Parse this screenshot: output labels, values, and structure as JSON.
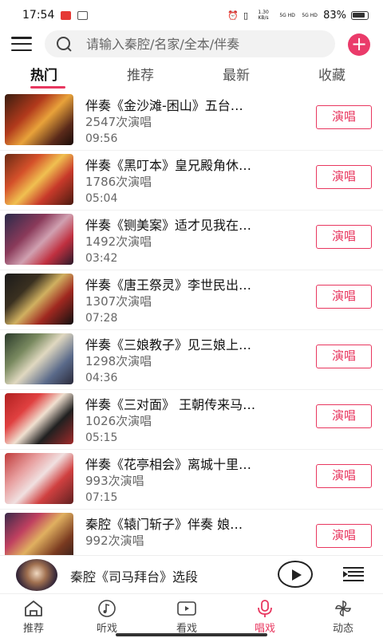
{
  "status_bar": {
    "time": "17:54",
    "network_speed": "1.30 KB/s",
    "signal_1": "5G HD",
    "signal_2": "5G HD",
    "battery": "83%"
  },
  "search": {
    "placeholder": "请输入秦腔/名家/全本/伴奏"
  },
  "tabs": [
    {
      "label": "热门",
      "active": true
    },
    {
      "label": "推荐",
      "active": false
    },
    {
      "label": "最新",
      "active": false
    },
    {
      "label": "收藏",
      "active": false
    }
  ],
  "items": [
    {
      "title": "伴奏《金沙滩-困山》五台…",
      "plays": "2547次演唱",
      "duration": "09:56",
      "button": "演唱"
    },
    {
      "title": "伴奏《黑叮本》皇兄殿角休…",
      "plays": "1786次演唱",
      "duration": "05:04",
      "button": "演唱"
    },
    {
      "title": "伴奏《铡美案》适才见我在…",
      "plays": "1492次演唱",
      "duration": "03:42",
      "button": "演唱"
    },
    {
      "title": "伴奏《唐王祭灵》李世民出…",
      "plays": "1307次演唱",
      "duration": "07:28",
      "button": "演唱"
    },
    {
      "title": "伴奏《三娘教子》见三娘上…",
      "plays": "1298次演唱",
      "duration": "04:36",
      "button": "演唱"
    },
    {
      "title": "伴奏《三对面》 王朝传来马…",
      "plays": "1026次演唱",
      "duration": "05:15",
      "button": "演唱"
    },
    {
      "title": "伴奏《花亭相会》离城十里…",
      "plays": "993次演唱",
      "duration": "07:15",
      "button": "演唱"
    },
    {
      "title": "秦腔《辕门斩子》伴奏 娘…",
      "plays": "992次演唱",
      "duration": "",
      "button": "演唱"
    }
  ],
  "player": {
    "title": "秦腔《司马拜台》选段"
  },
  "bottom_nav": [
    {
      "label": "推荐",
      "icon": "home-icon",
      "active": false
    },
    {
      "label": "听戏",
      "icon": "music-note-icon",
      "active": false
    },
    {
      "label": "看戏",
      "icon": "video-icon",
      "active": false
    },
    {
      "label": "唱戏",
      "icon": "microphone-icon",
      "active": true
    },
    {
      "label": "动态",
      "icon": "pinwheel-icon",
      "active": false
    }
  ],
  "colors": {
    "accent": "#e8375f",
    "add_button": "#ea3b6a",
    "search_bg": "#f2f2f2"
  }
}
